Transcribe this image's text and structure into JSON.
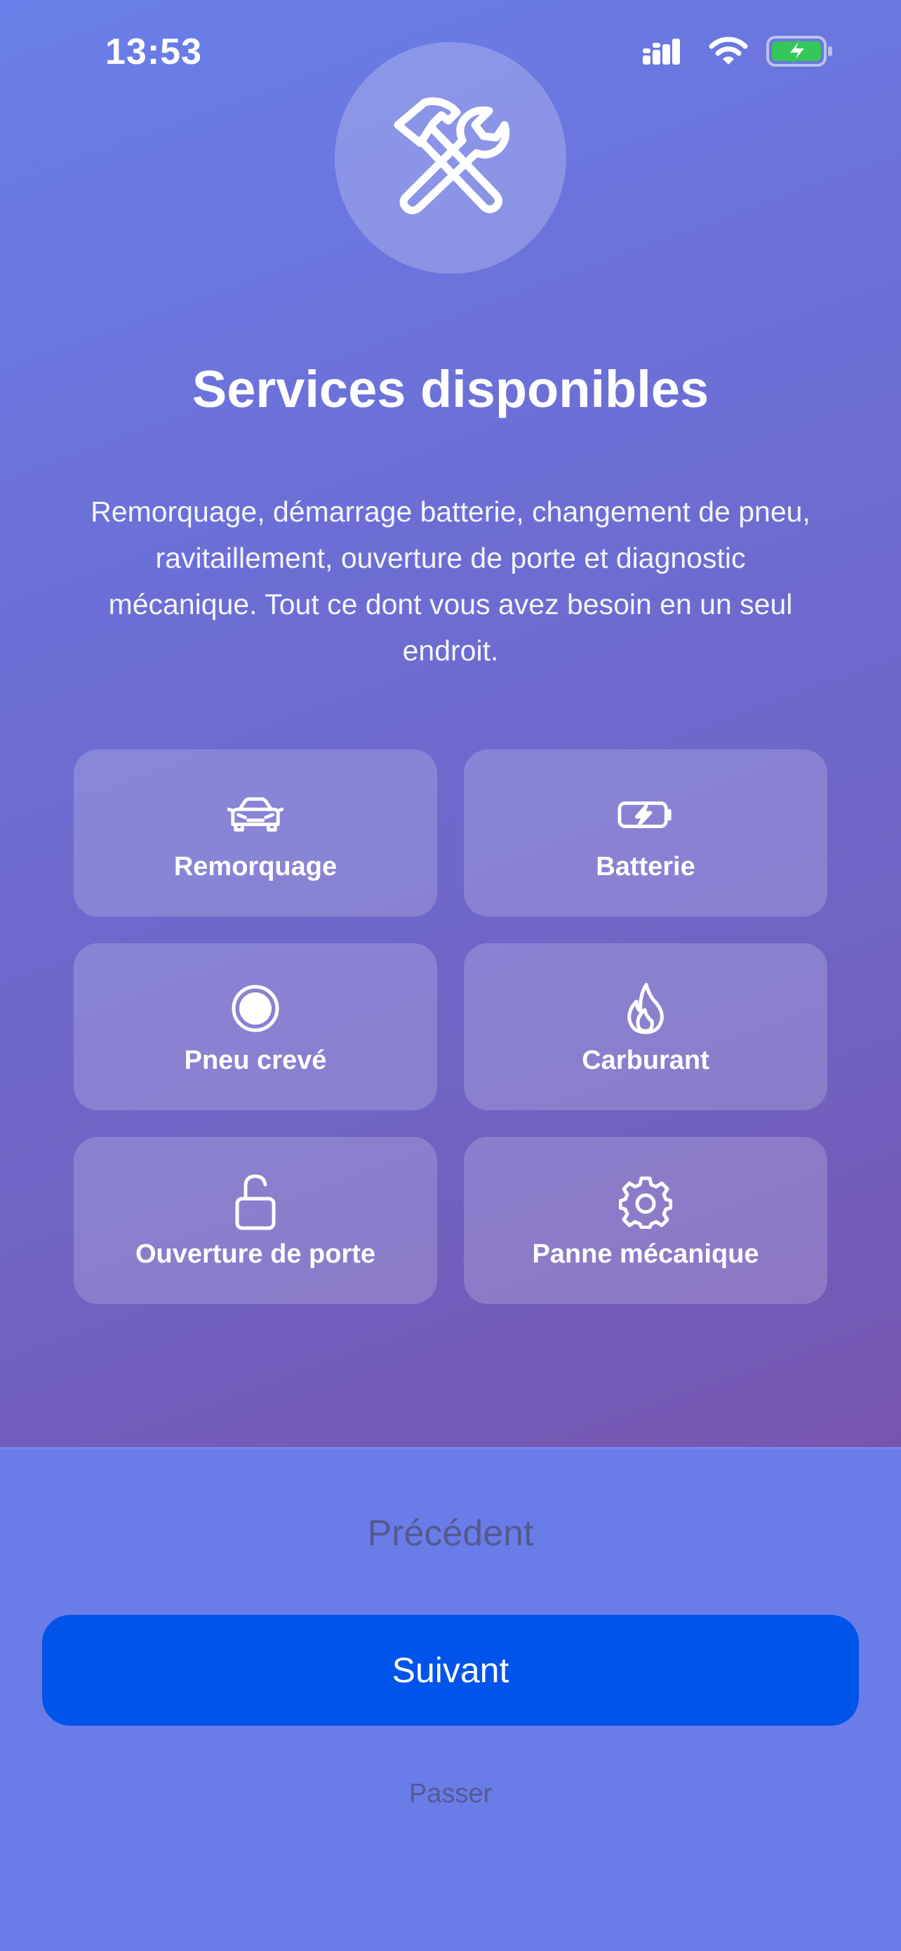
{
  "status_bar": {
    "time": "13:53"
  },
  "hero": {
    "icon": "hammer-wrench-icon",
    "title": "Services disponibles",
    "description": "Remorquage, démarrage batterie, changement de pneu, ravitaillement, ouverture de porte et diagnostic mécanique. Tout ce dont vous avez besoin en un seul endroit."
  },
  "services": [
    {
      "label": "Remorquage",
      "icon": "car-icon"
    },
    {
      "label": "Batterie",
      "icon": "battery-charging-icon"
    },
    {
      "label": "Pneu crevé",
      "icon": "tire-icon"
    },
    {
      "label": "Carburant",
      "icon": "flame-icon"
    },
    {
      "label": "Ouverture de porte",
      "icon": "unlocked-padlock-icon"
    },
    {
      "label": "Panne mécanique",
      "icon": "gear-icon"
    }
  ],
  "navigation": {
    "previous_label": "Précédent",
    "next_label": "Suivant",
    "skip_label": "Passer"
  },
  "colors": {
    "primary_button": "#0054ea",
    "battery_fill": "#34c759"
  }
}
